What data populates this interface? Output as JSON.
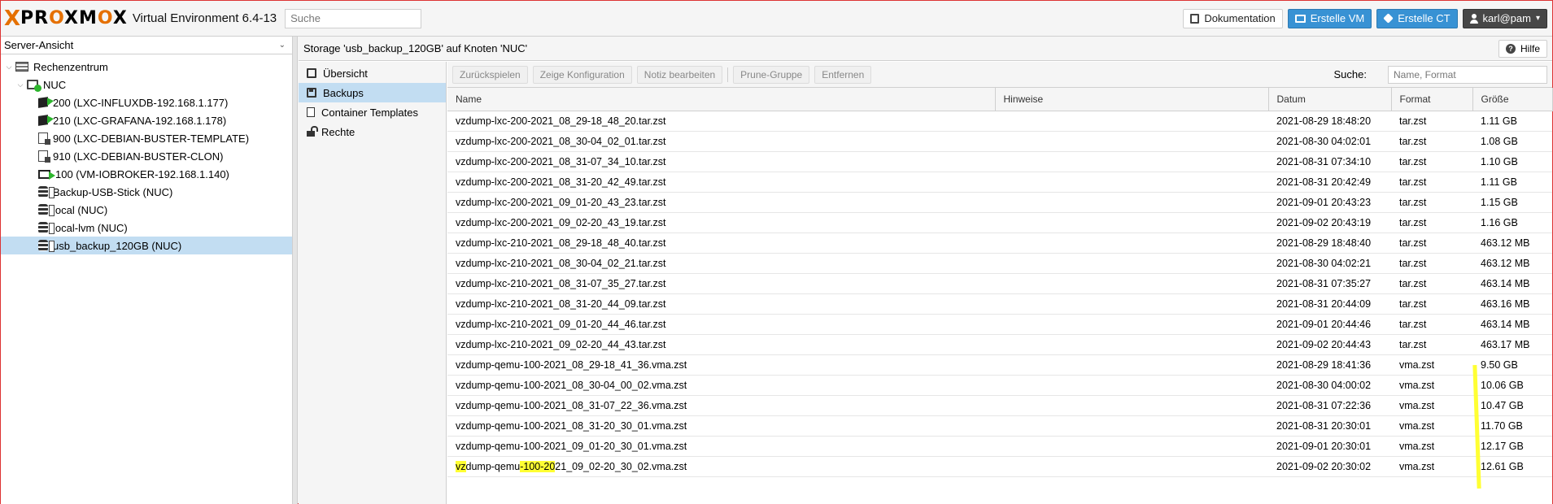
{
  "topbar": {
    "logo_text": "PROXMOX",
    "product": "Virtual Environment 6.4-13",
    "search_placeholder": "Suche",
    "docs_label": "Dokumentation",
    "create_vm_label": "Erstelle VM",
    "create_ct_label": "Erstelle CT",
    "user_label": "karl@pam"
  },
  "sidebar": {
    "view_label": "Server-Ansicht",
    "items": [
      {
        "label": "Rechenzentrum",
        "icon": "datacenter-icon"
      },
      {
        "label": "NUC",
        "icon": "node-icon"
      },
      {
        "label": "200 (LXC-INFLUXDB-192.168.1.177)",
        "icon": "container-running-icon"
      },
      {
        "label": "210 (LXC-GRAFANA-192.168.1.178)",
        "icon": "container-running-icon"
      },
      {
        "label": "900 (LXC-DEBIAN-BUSTER-TEMPLATE)",
        "icon": "template-icon"
      },
      {
        "label": "910 (LXC-DEBIAN-BUSTER-CLON)",
        "icon": "template-icon"
      },
      {
        "label": "100 (VM-IOBROKER-192.168.1.140)",
        "icon": "vm-running-icon"
      },
      {
        "label": "Backup-USB-Stick (NUC)",
        "icon": "storage-icon"
      },
      {
        "label": "local (NUC)",
        "icon": "storage-icon"
      },
      {
        "label": "local-lvm (NUC)",
        "icon": "storage-icon"
      },
      {
        "label": "usb_backup_120GB (NUC)",
        "icon": "storage-icon"
      }
    ]
  },
  "main": {
    "title": "Storage 'usb_backup_120GB' auf Knoten 'NUC'",
    "help_label": "Hilfe"
  },
  "subnav": {
    "items": [
      {
        "label": "Übersicht",
        "icon": "book-icon"
      },
      {
        "label": "Backups",
        "icon": "floppy-icon"
      },
      {
        "label": "Container Templates",
        "icon": "document-icon"
      },
      {
        "label": "Rechte",
        "icon": "unlock-icon"
      }
    ]
  },
  "toolbar": {
    "restore_label": "Zurückspielen",
    "show_config_label": "Zeige Konfiguration",
    "edit_note_label": "Notiz bearbeiten",
    "prune_label": "Prune-Gruppe",
    "remove_label": "Entfernen",
    "search_label": "Suche:",
    "search_placeholder": "Name, Format"
  },
  "table": {
    "columns": [
      "Name",
      "Hinweise",
      "Datum",
      "Format",
      "Größe"
    ],
    "rows": [
      {
        "name": "vzdump-lxc-200-2021_08_29-18_48_20.tar.zst",
        "notes": "",
        "date": "2021-08-29 18:48:20",
        "format": "tar.zst",
        "size": "1.11 GB"
      },
      {
        "name": "vzdump-lxc-200-2021_08_30-04_02_01.tar.zst",
        "notes": "",
        "date": "2021-08-30 04:02:01",
        "format": "tar.zst",
        "size": "1.08 GB"
      },
      {
        "name": "vzdump-lxc-200-2021_08_31-07_34_10.tar.zst",
        "notes": "",
        "date": "2021-08-31 07:34:10",
        "format": "tar.zst",
        "size": "1.10 GB"
      },
      {
        "name": "vzdump-lxc-200-2021_08_31-20_42_49.tar.zst",
        "notes": "",
        "date": "2021-08-31 20:42:49",
        "format": "tar.zst",
        "size": "1.11 GB"
      },
      {
        "name": "vzdump-lxc-200-2021_09_01-20_43_23.tar.zst",
        "notes": "",
        "date": "2021-09-01 20:43:23",
        "format": "tar.zst",
        "size": "1.15 GB"
      },
      {
        "name": "vzdump-lxc-200-2021_09_02-20_43_19.tar.zst",
        "notes": "",
        "date": "2021-09-02 20:43:19",
        "format": "tar.zst",
        "size": "1.16 GB"
      },
      {
        "name": "vzdump-lxc-210-2021_08_29-18_48_40.tar.zst",
        "notes": "",
        "date": "2021-08-29 18:48:40",
        "format": "tar.zst",
        "size": "463.12 MB"
      },
      {
        "name": "vzdump-lxc-210-2021_08_30-04_02_21.tar.zst",
        "notes": "",
        "date": "2021-08-30 04:02:21",
        "format": "tar.zst",
        "size": "463.12 MB"
      },
      {
        "name": "vzdump-lxc-210-2021_08_31-07_35_27.tar.zst",
        "notes": "",
        "date": "2021-08-31 07:35:27",
        "format": "tar.zst",
        "size": "463.14 MB"
      },
      {
        "name": "vzdump-lxc-210-2021_08_31-20_44_09.tar.zst",
        "notes": "",
        "date": "2021-08-31 20:44:09",
        "format": "tar.zst",
        "size": "463.16 MB"
      },
      {
        "name": "vzdump-lxc-210-2021_09_01-20_44_46.tar.zst",
        "notes": "",
        "date": "2021-09-01 20:44:46",
        "format": "tar.zst",
        "size": "463.14 MB"
      },
      {
        "name": "vzdump-lxc-210-2021_09_02-20_44_43.tar.zst",
        "notes": "",
        "date": "2021-09-02 20:44:43",
        "format": "tar.zst",
        "size": "463.17 MB"
      },
      {
        "name": "vzdump-qemu-100-2021_08_29-18_41_36.vma.zst",
        "notes": "",
        "date": "2021-08-29 18:41:36",
        "format": "vma.zst",
        "size": "9.50 GB"
      },
      {
        "name": "vzdump-qemu-100-2021_08_30-04_00_02.vma.zst",
        "notes": "",
        "date": "2021-08-30 04:00:02",
        "format": "vma.zst",
        "size": "10.06 GB"
      },
      {
        "name": "vzdump-qemu-100-2021_08_31-07_22_36.vma.zst",
        "notes": "",
        "date": "2021-08-31 07:22:36",
        "format": "vma.zst",
        "size": "10.47 GB"
      },
      {
        "name": "vzdump-qemu-100-2021_08_31-20_30_01.vma.zst",
        "notes": "",
        "date": "2021-08-31 20:30:01",
        "format": "vma.zst",
        "size": "11.70 GB"
      },
      {
        "name": "vzdump-qemu-100-2021_09_01-20_30_01.vma.zst",
        "notes": "",
        "date": "2021-09-01 20:30:01",
        "format": "vma.zst",
        "size": "12.17 GB"
      },
      {
        "name": "vzdump-qemu-100-2021_09_02-20_30_02.vma.zst",
        "notes": "",
        "date": "2021-09-02 20:30:02",
        "format": "vma.zst",
        "size": "12.61 GB"
      }
    ],
    "last_row_name_parts": [
      "vz",
      "dump-qemu",
      "-100-20",
      "21_09_02-20_30_02.vma.zst"
    ]
  },
  "colors": {
    "accent_blue": "#3892d4",
    "selection": "#c2ddf2",
    "running_green": "#2db52d",
    "logo_orange": "#e57000",
    "highlight_yellow": "#ffff33"
  }
}
